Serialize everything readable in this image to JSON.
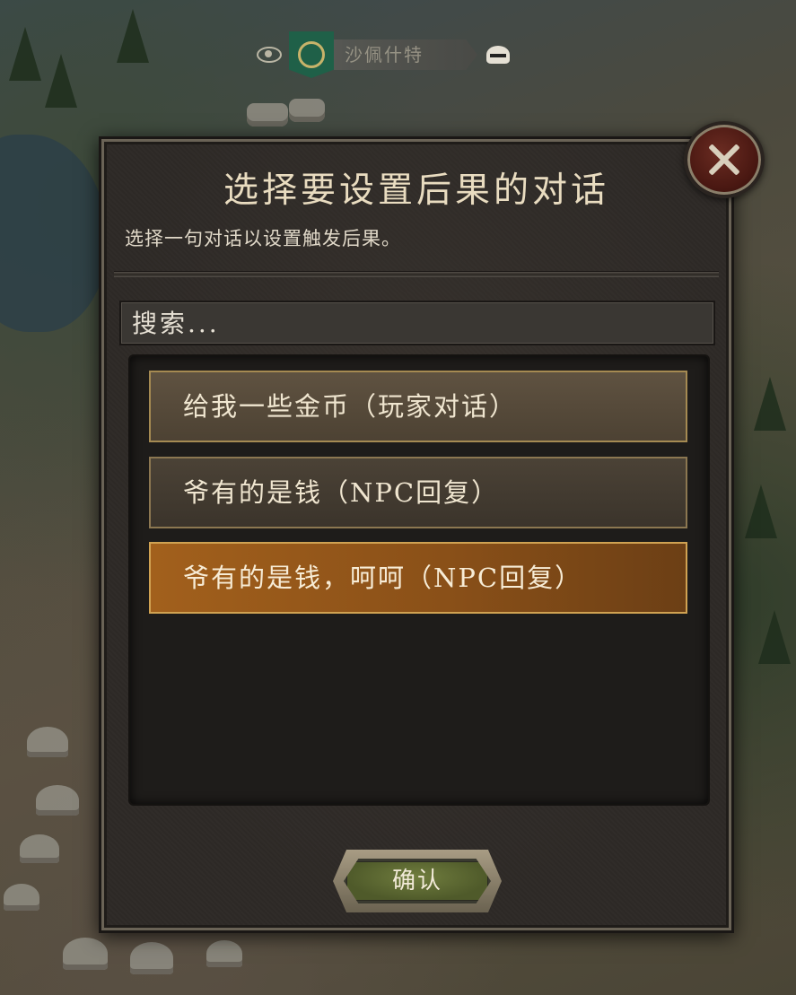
{
  "map": {
    "faction_name": "沙佩什特",
    "banner_color": "#1f6048"
  },
  "dialog": {
    "title": "选择要设置后果的对话",
    "subtitle": "选择一句对话以设置触发后果。",
    "search": {
      "value": "搜索...",
      "placeholder": "搜索..."
    },
    "items": [
      {
        "label": "给我一些金币（玩家对话）",
        "selected": false
      },
      {
        "label": "爷有的是钱（NPC回复）",
        "selected": false
      },
      {
        "label": "爷有的是钱，呵呵（NPC回复）",
        "selected": true
      }
    ],
    "confirm_label": "确认",
    "selected_color": "#a2601c"
  }
}
